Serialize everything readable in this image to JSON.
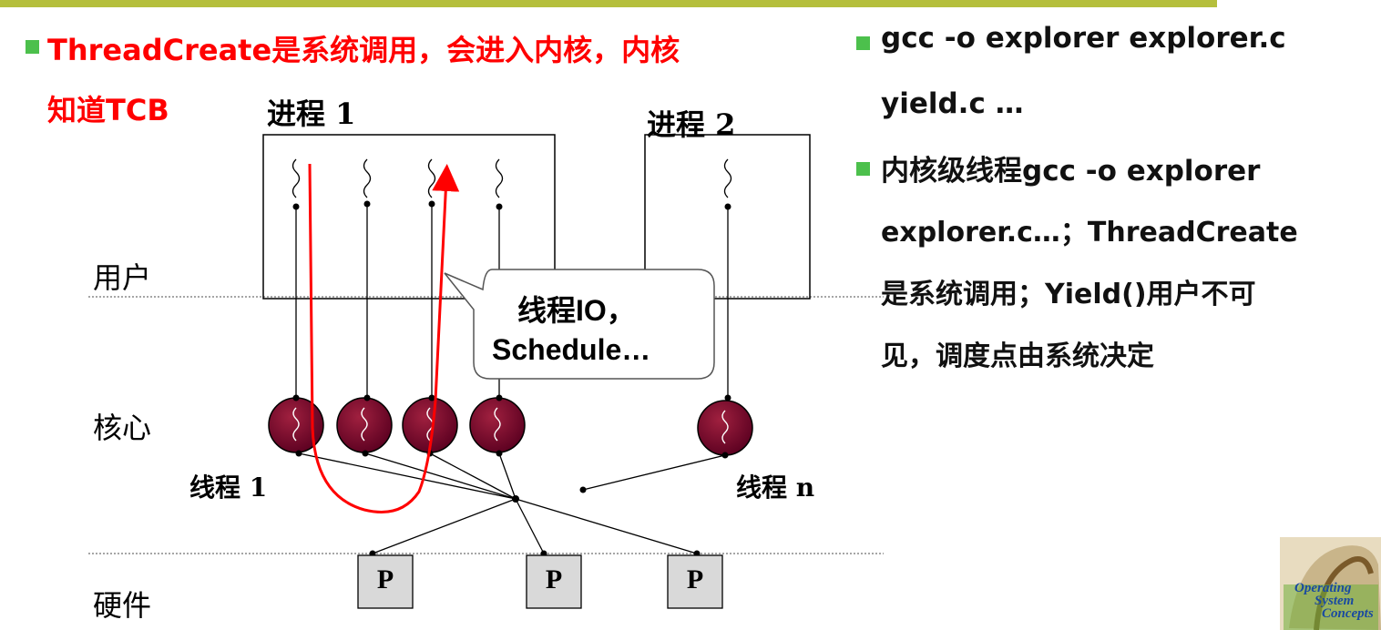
{
  "left_bullet": {
    "line1": "ThreadCreate是系统调用，会进入内核，内核",
    "line2": "知道TCB"
  },
  "diagram": {
    "process1_label": "进程 1",
    "process2_label": "进程 2",
    "zone_user": "用户",
    "zone_kernel": "核心",
    "zone_hardware": "硬件",
    "thread_first_label": "线程 1",
    "thread_last_label": "线程 n",
    "callout_line1": "线程IO，",
    "callout_line2": "Schedule…",
    "processors": [
      "P",
      "P",
      "P"
    ]
  },
  "right_bullets": [
    {
      "lines": [
        "gcc -o explorer explorer.c",
        "yield.c …"
      ]
    },
    {
      "lines": [
        "内核级线程gcc -o explorer",
        "explorer.c…；ThreadCreate",
        "是系统调用；Yield()用户不可",
        "见，调度点由系统决定"
      ]
    }
  ],
  "logo": {
    "line1": "Operating",
    "line2": "System",
    "line3": "Concepts"
  },
  "colors": {
    "accent_bar": "#b5bf3c",
    "bullet": "#4cc04c",
    "highlight": "#ff0000",
    "kernel_thread": "#7a0a2a"
  }
}
